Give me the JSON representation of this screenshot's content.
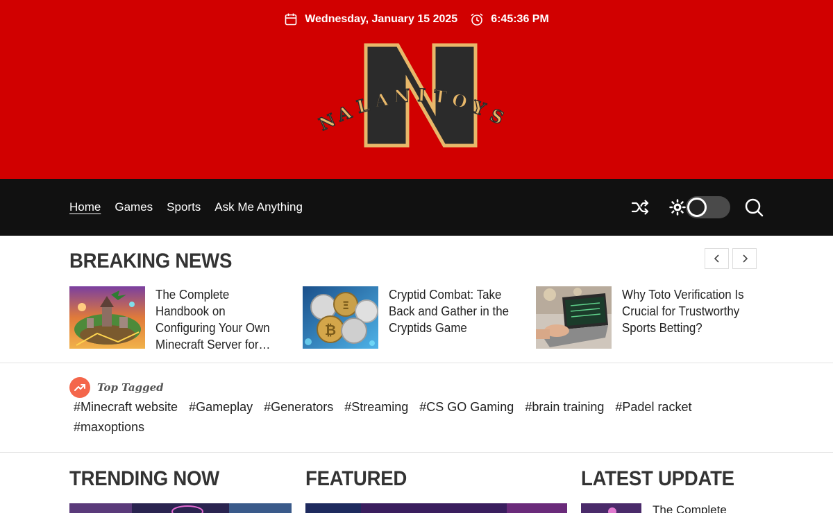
{
  "header": {
    "date": "Wednesday, January 15 2025",
    "time": "6:45:36 PM",
    "logo_big_letter": "N",
    "logo_text": "NALANITOYS",
    "colors": {
      "background": "#d10000",
      "logo_dark": "#2b2b2b",
      "logo_gold": "#e8b86a"
    }
  },
  "nav": {
    "links": [
      {
        "label": "Home",
        "active": true
      },
      {
        "label": "Games",
        "active": false
      },
      {
        "label": "Sports",
        "active": false
      },
      {
        "label": "Ask Me Anything",
        "active": false
      }
    ],
    "icons": [
      "shuffle-icon",
      "sun-icon",
      "dark-mode-toggle",
      "search-icon"
    ]
  },
  "breaking_news": {
    "title": "BREAKING NEWS",
    "items": [
      {
        "title": "The Complete Handbook on Configuring Your Own Minecraft Server for…",
        "image": "minecraft-fantasy-island"
      },
      {
        "title": "Cryptid Combat: Take Back and Gather in the Cryptids Game",
        "image": "crypto-coins"
      },
      {
        "title": "Why Toto Verification Is Crucial for Trustworthy Sports Betting?",
        "image": "laptop-sports-betting"
      }
    ]
  },
  "top_tagged": {
    "heading": "Top Tagged",
    "tags": [
      "#Minecraft website",
      "#Gameplay",
      "#Generators",
      "#Streaming",
      "#CS GO Gaming",
      "#brain training",
      "#Padel racket",
      "#maxoptions"
    ]
  },
  "sections": {
    "trending": "TRENDING NOW",
    "featured": "FEATURED",
    "latest": "LATEST UPDATE",
    "latest_first_title": "The Complete"
  }
}
